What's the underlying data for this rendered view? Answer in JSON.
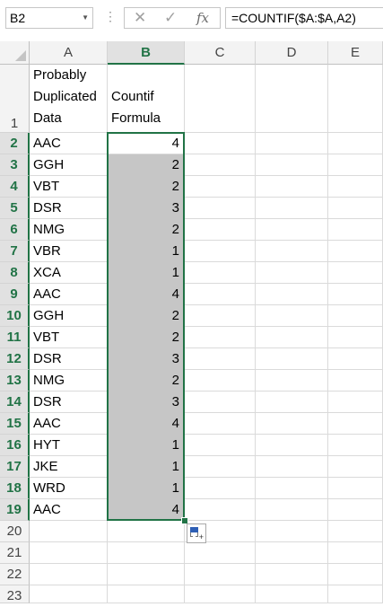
{
  "formula_bar": {
    "name_box": "B2",
    "cancel_icon": "✕",
    "enter_icon": "✓",
    "fx_label": "fx",
    "formula": "=COUNTIF($A:$A,A2)"
  },
  "columns": [
    "A",
    "B",
    "C",
    "D",
    "E"
  ],
  "selected_column": "B",
  "header_row": {
    "row_number": "1",
    "a_line1": "Probably",
    "a_line2": "Duplicated",
    "a_line3": "Data",
    "b_line1": "Countif",
    "b_line2": "Formula"
  },
  "rows": [
    {
      "row": "2",
      "a": "AAC",
      "b": "4"
    },
    {
      "row": "3",
      "a": "GGH",
      "b": "2"
    },
    {
      "row": "4",
      "a": "VBT",
      "b": "2"
    },
    {
      "row": "5",
      "a": "DSR",
      "b": "3"
    },
    {
      "row": "6",
      "a": "NMG",
      "b": "2"
    },
    {
      "row": "7",
      "a": "VBR",
      "b": "1"
    },
    {
      "row": "8",
      "a": "XCA",
      "b": "1"
    },
    {
      "row": "9",
      "a": "AAC",
      "b": "4"
    },
    {
      "row": "10",
      "a": "GGH",
      "b": "2"
    },
    {
      "row": "11",
      "a": "VBT",
      "b": "2"
    },
    {
      "row": "12",
      "a": "DSR",
      "b": "3"
    },
    {
      "row": "13",
      "a": "NMG",
      "b": "2"
    },
    {
      "row": "14",
      "a": "DSR",
      "b": "3"
    },
    {
      "row": "15",
      "a": "AAC",
      "b": "4"
    },
    {
      "row": "16",
      "a": "HYT",
      "b": "1"
    },
    {
      "row": "17",
      "a": "JKE",
      "b": "1"
    },
    {
      "row": "18",
      "a": "WRD",
      "b": "1"
    },
    {
      "row": "19",
      "a": "AAC",
      "b": "4"
    }
  ],
  "empty_rows": [
    "20",
    "21",
    "22",
    "23"
  ],
  "colors": {
    "selection": "#217346",
    "selected_fill": "#c6c6c6",
    "header_bg": "#f3f3f3"
  }
}
